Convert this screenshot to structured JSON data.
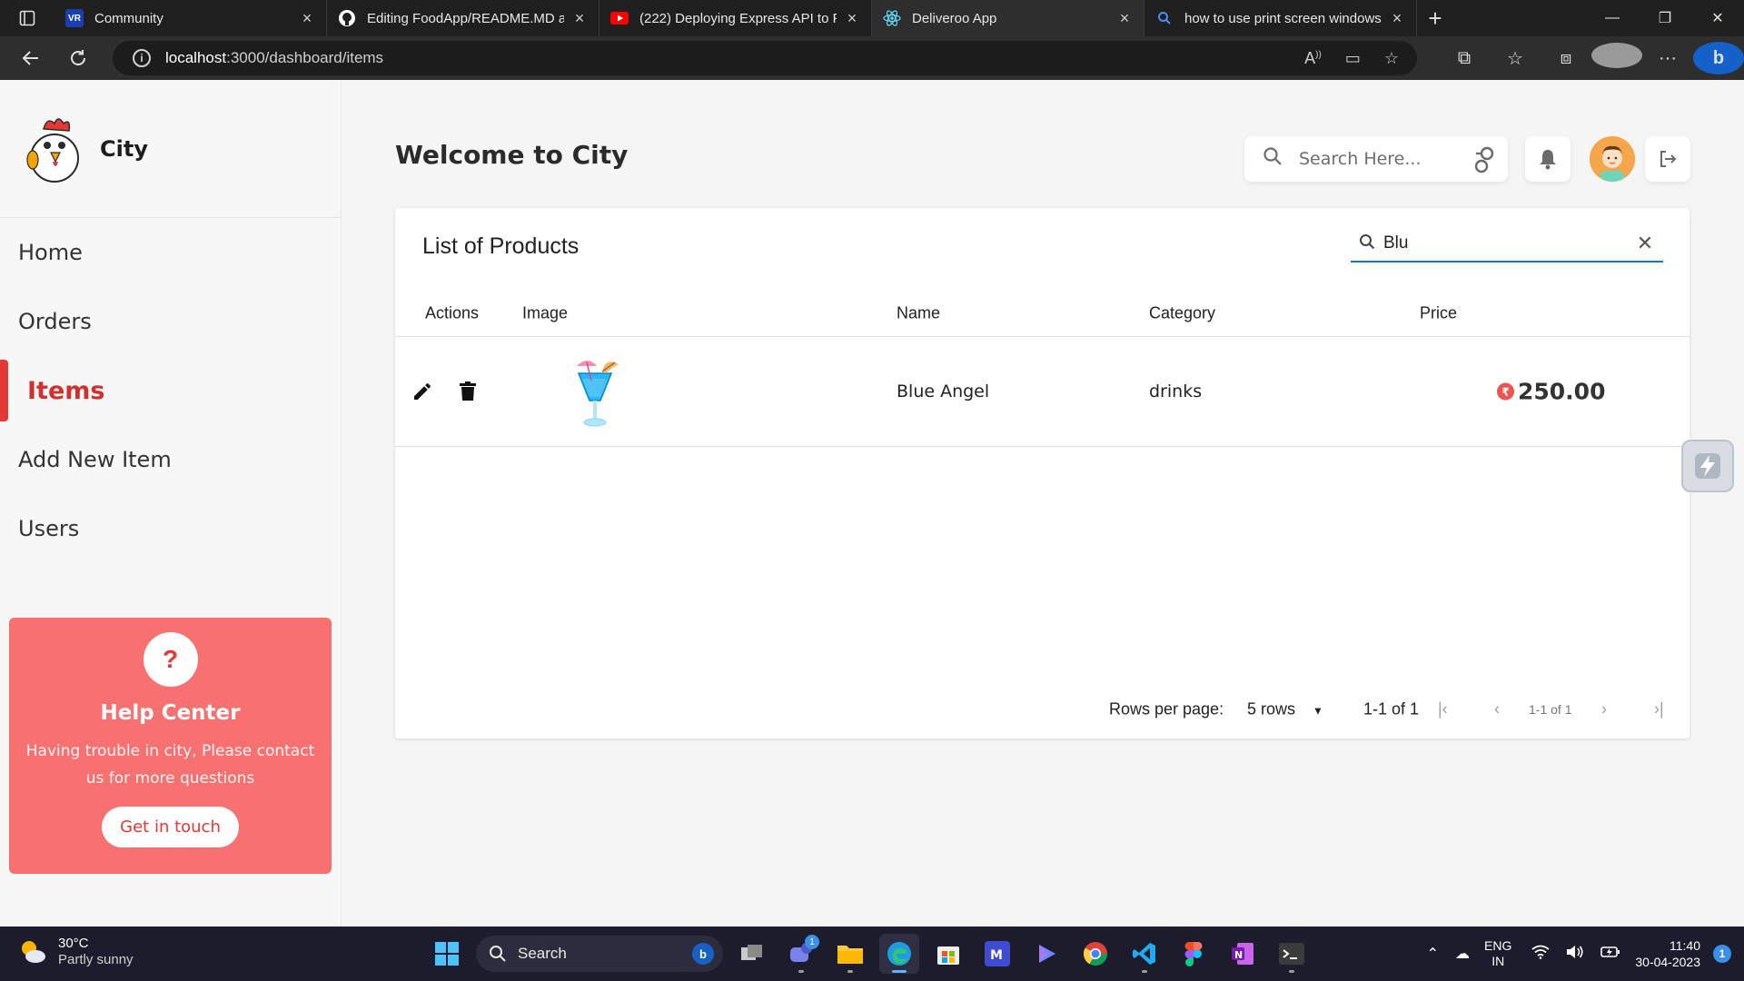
{
  "browser": {
    "tabs": [
      {
        "title": "Community",
        "favicon": "VR",
        "active": false
      },
      {
        "title": "Editing FoodApp/README.MD at",
        "favicon": "github-icon",
        "active": false
      },
      {
        "title": "(222) Deploying Express API to Fi",
        "favicon": "youtube-icon",
        "active": false
      },
      {
        "title": "Deliveroo App",
        "favicon": "react-icon",
        "active": true
      },
      {
        "title": "how to use print screen windows",
        "favicon": "search-icon",
        "active": false
      }
    ],
    "url_host": "localhost",
    "url_path": ":3000/dashboard/items"
  },
  "sidebar": {
    "brand": "City",
    "items": [
      {
        "label": "Home"
      },
      {
        "label": "Orders"
      },
      {
        "label": "Items"
      },
      {
        "label": "Add New Item"
      },
      {
        "label": "Users"
      }
    ],
    "help": {
      "icon": "?",
      "title": "Help Center",
      "text": "Having trouble in city, Please contact us for more questions",
      "button": "Get in touch"
    }
  },
  "header": {
    "title": "Welcome to City",
    "search_placeholder": "Search Here..."
  },
  "products": {
    "title": "List of Products",
    "search_value": "Blu",
    "columns": [
      "Actions",
      "Image",
      "Name",
      "Category",
      "Price"
    ],
    "rows": [
      {
        "name": "Blue Angel",
        "category": "drinks",
        "price": "250.00"
      }
    ],
    "pagination": {
      "rows_label": "Rows per page:",
      "rows_value": "5 rows",
      "range": "1-1 of 1",
      "page_info": "1-1 of 1"
    }
  },
  "taskbar": {
    "weather_temp": "30°C",
    "weather_desc": "Partly sunny",
    "search": "Search",
    "lang_1": "ENG",
    "lang_2": "IN",
    "time": "11:40",
    "date": "30-04-2023",
    "notifications": "1",
    "teams_badge": "1"
  },
  "colors": {
    "accent": "#e53935",
    "help_bg": "#f87171",
    "link_blue": "#1976d2"
  }
}
